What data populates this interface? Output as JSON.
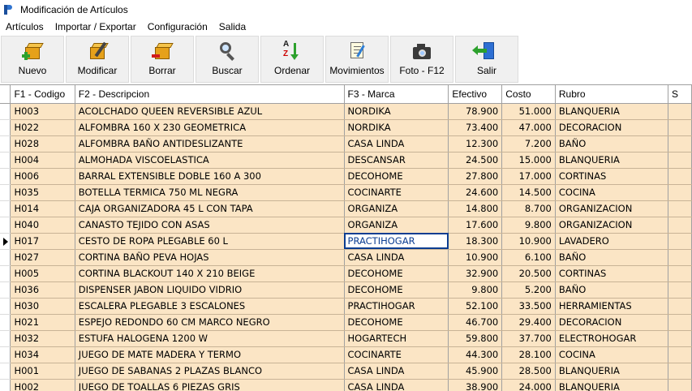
{
  "window": {
    "title": "Modificación de Artículos"
  },
  "menu": [
    "Artículos",
    "Importar / Exportar",
    "Configuración",
    "Salida"
  ],
  "toolbar": {
    "buttons": [
      {
        "label": "Nuevo",
        "icon": "new-box-icon"
      },
      {
        "label": "Modificar",
        "icon": "edit-box-icon"
      },
      {
        "label": "Borrar",
        "icon": "delete-box-icon"
      },
      {
        "label": "Buscar",
        "icon": "magnifier-icon"
      },
      {
        "label": "Ordenar",
        "icon": "sort-az-icon"
      },
      {
        "label": "Movimientos",
        "icon": "document-edit-icon"
      },
      {
        "label": "Foto - F12",
        "icon": "camera-icon"
      },
      {
        "label": "Salir",
        "icon": "exit-door-icon"
      }
    ]
  },
  "grid": {
    "columns": [
      "F1 - Codigo",
      "F2 - Descripcion",
      "F3 - Marca",
      "Efectivo",
      "Costo",
      "Rubro",
      "S"
    ],
    "current_row": 8,
    "editing_cell": {
      "row": 8,
      "column": "marca"
    },
    "rows": [
      {
        "codigo": "H003",
        "descripcion": "ACOLCHADO QUEEN REVERSIBLE AZUL",
        "marca": "NORDIKA",
        "efectivo": "78.900",
        "costo": "51.000",
        "rubro": "BLANQUERIA"
      },
      {
        "codigo": "H022",
        "descripcion": "ALFOMBRA 160 X 230 GEOMETRICA",
        "marca": "NORDIKA",
        "efectivo": "73.400",
        "costo": "47.000",
        "rubro": "DECORACION"
      },
      {
        "codigo": "H028",
        "descripcion": "ALFOMBRA BAÑO ANTIDESLIZANTE",
        "marca": "CASA LINDA",
        "efectivo": "12.300",
        "costo": "7.200",
        "rubro": "BAÑO"
      },
      {
        "codigo": "H004",
        "descripcion": "ALMOHADA VISCOELASTICA",
        "marca": "DESCANSAR",
        "efectivo": "24.500",
        "costo": "15.000",
        "rubro": "BLANQUERIA"
      },
      {
        "codigo": "H006",
        "descripcion": "BARRAL EXTENSIBLE DOBLE 160 A 300",
        "marca": "DECOHOME",
        "efectivo": "27.800",
        "costo": "17.000",
        "rubro": "CORTINAS"
      },
      {
        "codigo": "H035",
        "descripcion": "BOTELLA TERMICA 750 ML NEGRA",
        "marca": "COCINARTE",
        "efectivo": "24.600",
        "costo": "14.500",
        "rubro": "COCINA"
      },
      {
        "codigo": "H014",
        "descripcion": "CAJA ORGANIZADORA 45 L CON TAPA",
        "marca": "ORGANIZA",
        "efectivo": "14.800",
        "costo": "8.700",
        "rubro": "ORGANIZACION"
      },
      {
        "codigo": "H040",
        "descripcion": "CANASTO TEJIDO CON ASAS",
        "marca": "ORGANIZA",
        "efectivo": "17.600",
        "costo": "9.800",
        "rubro": "ORGANIZACION"
      },
      {
        "codigo": "H017",
        "descripcion": "CESTO DE ROPA PLEGABLE 60 L",
        "marca": "PRACTIHOGAR",
        "efectivo": "18.300",
        "costo": "10.900",
        "rubro": "LAVADERO"
      },
      {
        "codigo": "H027",
        "descripcion": "CORTINA BAÑO PEVA HOJAS",
        "marca": "CASA LINDA",
        "efectivo": "10.900",
        "costo": "6.100",
        "rubro": "BAÑO"
      },
      {
        "codigo": "H005",
        "descripcion": "CORTINA BLACKOUT 140 X 210 BEIGE",
        "marca": "DECOHOME",
        "efectivo": "32.900",
        "costo": "20.500",
        "rubro": "CORTINAS"
      },
      {
        "codigo": "H036",
        "descripcion": "DISPENSER JABON LIQUIDO VIDRIO",
        "marca": "DECOHOME",
        "efectivo": "9.800",
        "costo": "5.200",
        "rubro": "BAÑO"
      },
      {
        "codigo": "H030",
        "descripcion": "ESCALERA PLEGABLE 3 ESCALONES",
        "marca": "PRACTIHOGAR",
        "efectivo": "52.100",
        "costo": "33.500",
        "rubro": "HERRAMIENTAS"
      },
      {
        "codigo": "H021",
        "descripcion": "ESPEJO REDONDO 60 CM MARCO NEGRO",
        "marca": "DECOHOME",
        "efectivo": "46.700",
        "costo": "29.400",
        "rubro": "DECORACION"
      },
      {
        "codigo": "H032",
        "descripcion": "ESTUFA HALOGENA 1200 W",
        "marca": "HOGARTECH",
        "efectivo": "59.800",
        "costo": "37.700",
        "rubro": "ELECTROHOGAR"
      },
      {
        "codigo": "H034",
        "descripcion": "JUEGO DE MATE MADERA Y TERMO",
        "marca": "COCINARTE",
        "efectivo": "44.300",
        "costo": "28.100",
        "rubro": "COCINA"
      },
      {
        "codigo": "H001",
        "descripcion": "JUEGO DE SABANAS 2 PLAZAS BLANCO",
        "marca": "CASA LINDA",
        "efectivo": "45.900",
        "costo": "28.500",
        "rubro": "BLANQUERIA"
      },
      {
        "codigo": "H002",
        "descripcion": "JUEGO DE TOALLAS 6 PIEZAS GRIS",
        "marca": "CASA LINDA",
        "efectivo": "38.900",
        "costo": "24.000",
        "rubro": "BLANQUERIA"
      }
    ]
  }
}
